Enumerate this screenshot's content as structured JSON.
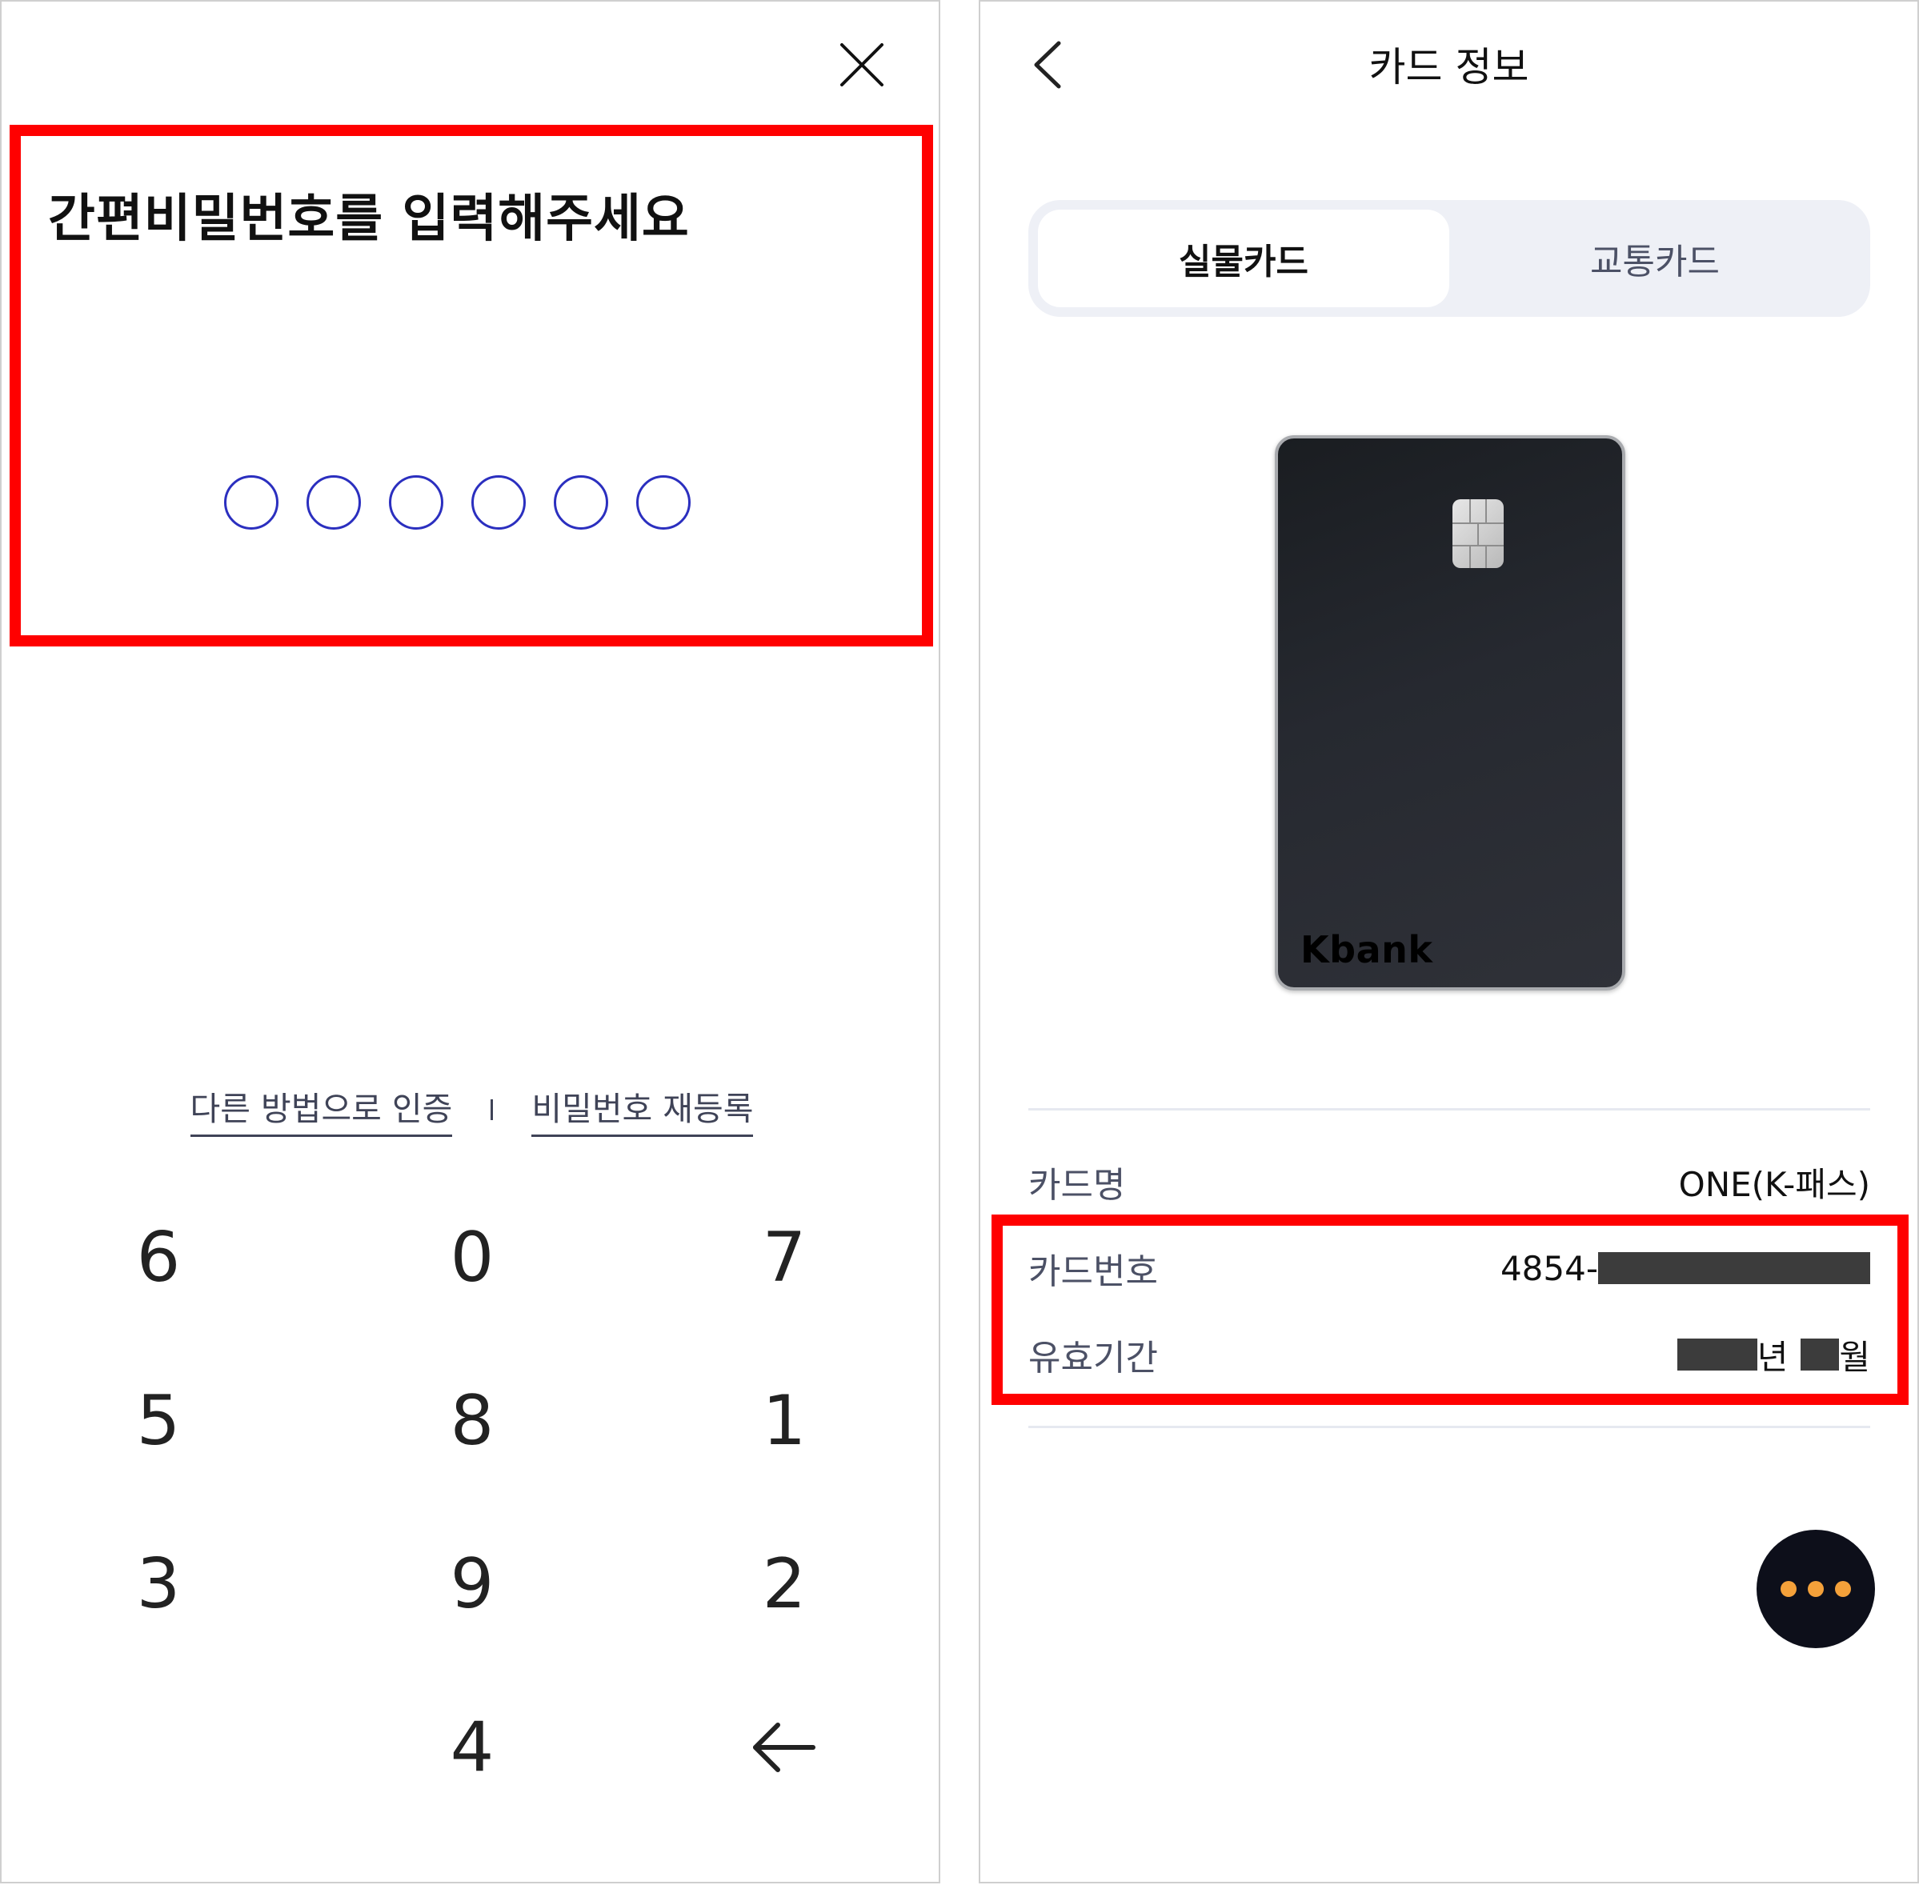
{
  "pin_screen": {
    "title": "간편비밀번호를 입력해주세요",
    "pin_length": 6,
    "links": {
      "alt_auth": "다른 방법으로 인증",
      "separator": "|",
      "reset_pin": "비밀번호 재등록"
    },
    "keypad": {
      "row1": [
        "6",
        "0",
        "7"
      ],
      "row2": [
        "5",
        "8",
        "1"
      ],
      "row3": [
        "3",
        "9",
        "2"
      ],
      "row4": [
        "4"
      ]
    },
    "icons": {
      "close": "close-icon",
      "backspace": "backspace-arrow-icon"
    }
  },
  "card_screen": {
    "header_title": "카드 정보",
    "tabs": [
      {
        "label": "실물카드",
        "active": true
      },
      {
        "label": "교통카드",
        "active": false
      }
    ],
    "card_brand": "Kbank",
    "info": {
      "card_name_label": "카드명",
      "card_name_value": "ONE(K-패스)",
      "card_number_label": "카드번호",
      "card_number_prefix": "4854-",
      "expiry_label": "유효기간",
      "expiry_year_suffix": "년",
      "expiry_month_suffix": "월"
    },
    "icons": {
      "back": "chevron-left-icon",
      "more": "more-dots-icon"
    }
  },
  "colors": {
    "highlight": "#ff0000",
    "pin_dot": "#2b2fbf",
    "fab_bg": "#0d0f1a",
    "fab_dots": "#f4a13a",
    "tab_bg": "#eef0f6"
  }
}
